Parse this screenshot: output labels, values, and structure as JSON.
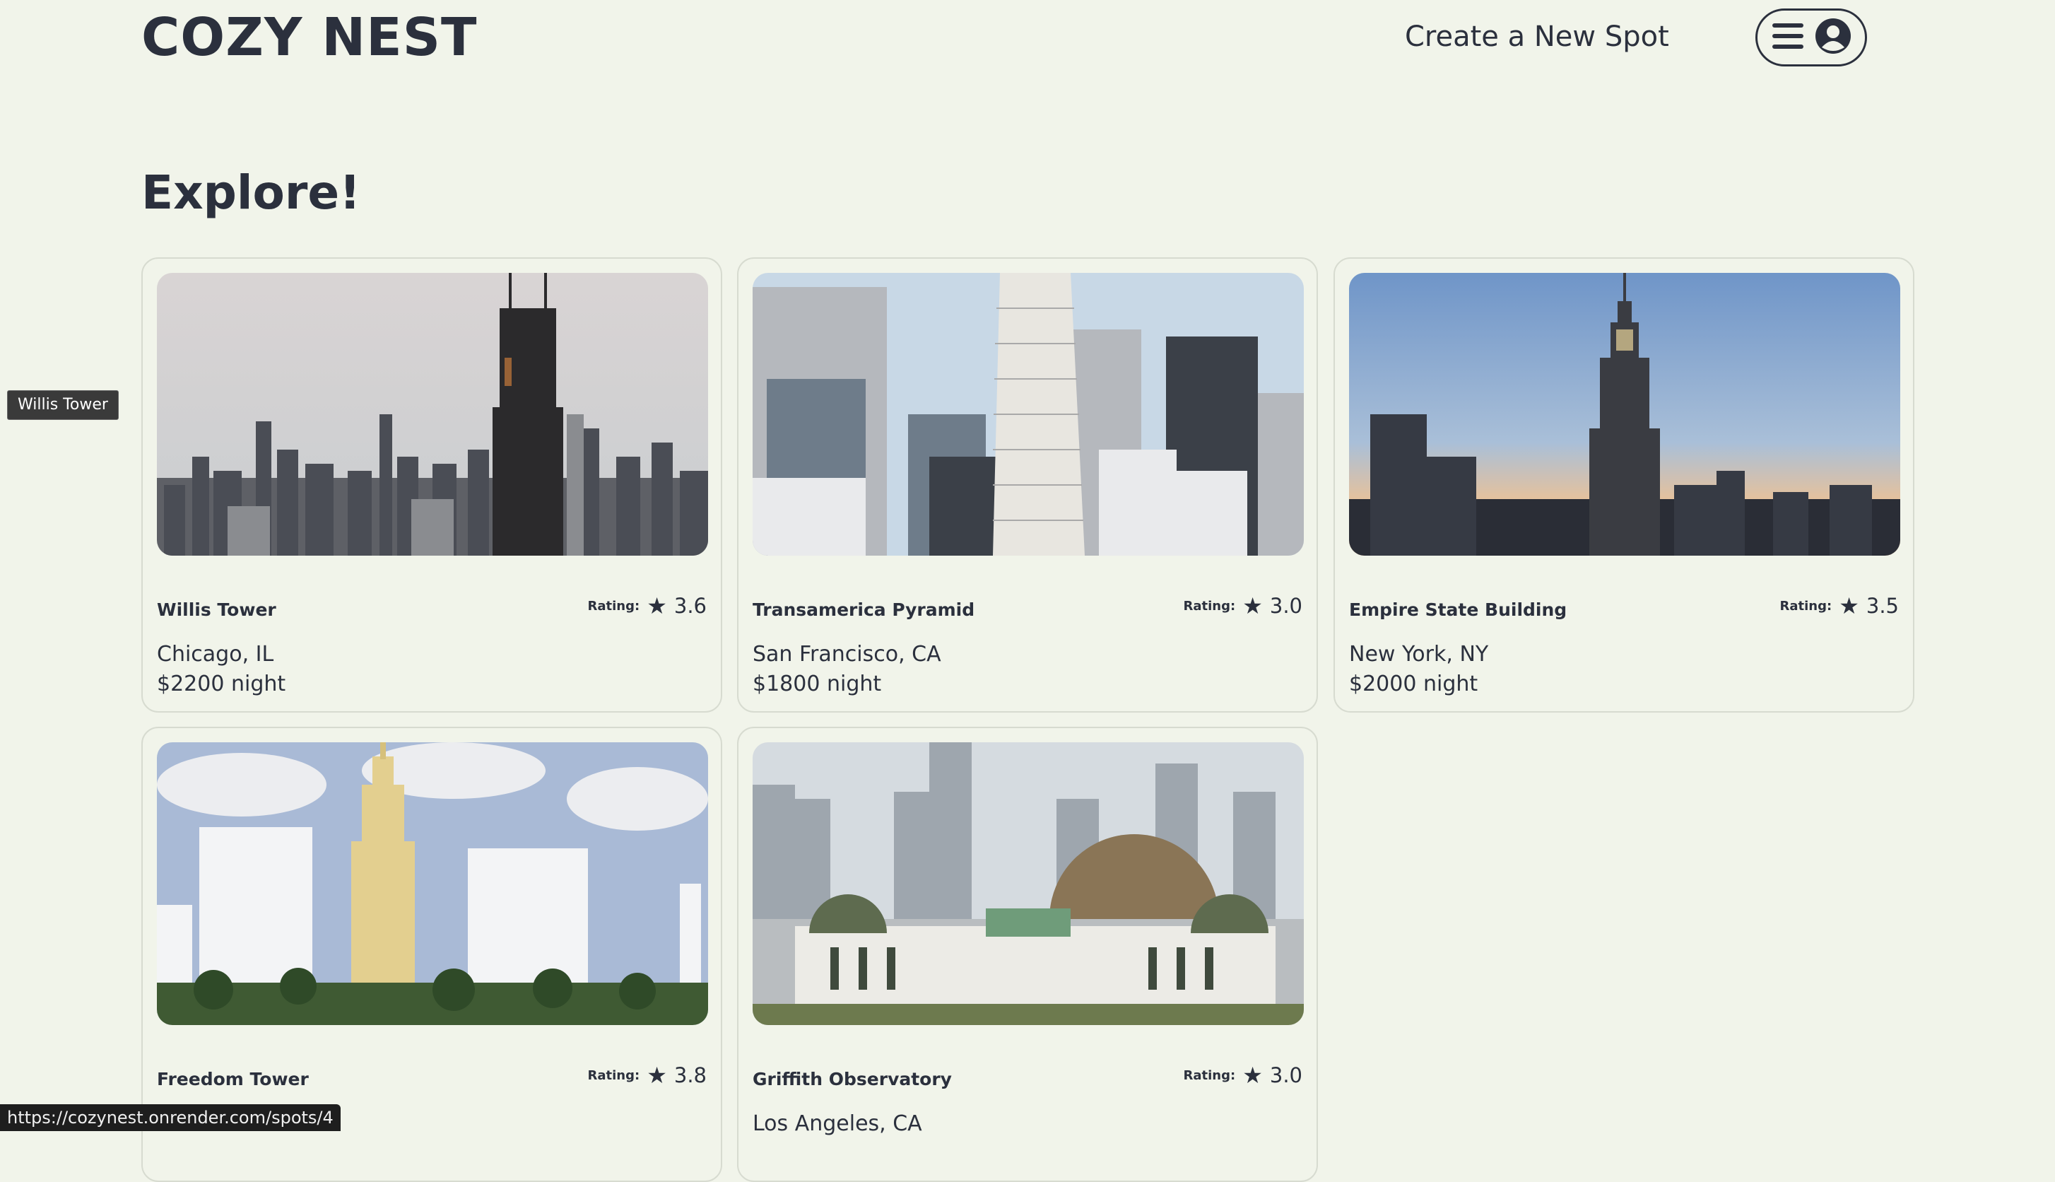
{
  "header": {
    "logo": "COZY NEST",
    "create_link": "Create a New Spot",
    "menu_icon": "hamburger-icon",
    "user_icon": "user-circle-icon"
  },
  "main": {
    "title": "Explore!"
  },
  "tooltip": "Willis Tower",
  "spots": [
    {
      "name": "Willis Tower",
      "rating_label": "Rating:",
      "rating": "3.6",
      "location": "Chicago, IL",
      "price": "$2200 night"
    },
    {
      "name": "Transamerica Pyramid",
      "rating_label": "Rating:",
      "rating": "3.0",
      "location": "San Francisco, CA",
      "price": "$1800 night"
    },
    {
      "name": "Empire State Building",
      "rating_label": "Rating:",
      "rating": "3.5",
      "location": "New York, NY",
      "price": "$2000 night"
    },
    {
      "name": "Freedom Tower",
      "rating_label": "Rating:",
      "rating": "3.8",
      "location": "",
      "price": ""
    },
    {
      "name": "Griffith Observatory",
      "rating_label": "Rating:",
      "rating": "3.0",
      "location": "Los Angeles, CA",
      "price": ""
    }
  ],
  "status_url": "https://cozynest.onrender.com/spots/4",
  "colors": {
    "background": "#f1f4ea",
    "text": "#2b303d",
    "card_border": "#d7dbd0"
  }
}
